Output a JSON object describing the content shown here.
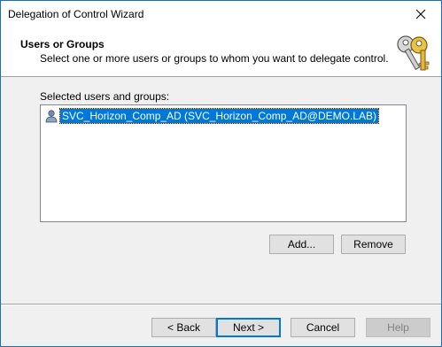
{
  "window": {
    "title": "Delegation of Control Wizard",
    "close_glyph": "✕"
  },
  "header": {
    "title": "Users or Groups",
    "subtitle": "Select one or more users or groups to whom you want to delegate control.",
    "icon": "keys-icon"
  },
  "list": {
    "label": "Selected users and groups:",
    "items": [
      {
        "label": "SVC_Horizon_Comp_AD (SVC_Horizon_Comp_AD@DEMO.LAB)",
        "icon": "user-icon",
        "selected": true
      }
    ]
  },
  "buttons": {
    "add": "Add...",
    "remove": "Remove",
    "back": "< Back",
    "next": "Next >",
    "cancel": "Cancel",
    "help": "Help"
  },
  "colors": {
    "selection": "#0078d7",
    "window_border": "#1a6fbf",
    "dialog_bg": "#f0f0f0"
  }
}
